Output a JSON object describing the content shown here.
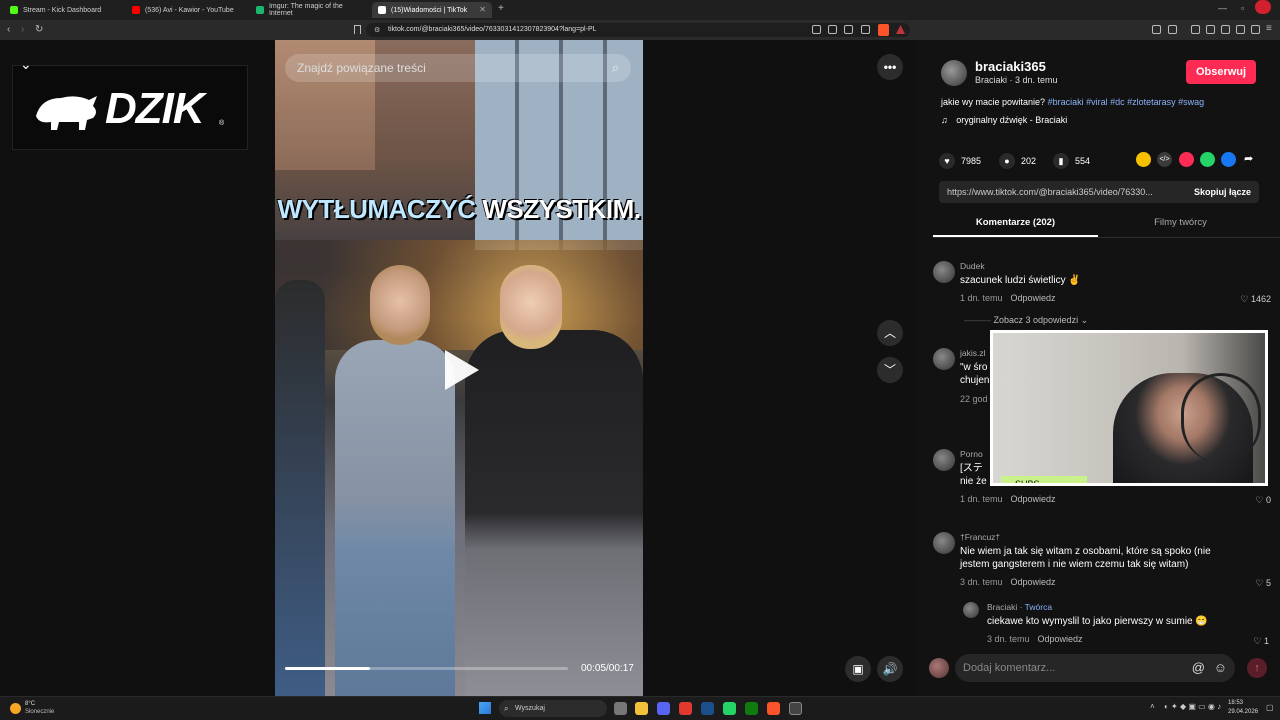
{
  "browser": {
    "tabs": [
      {
        "label": "Stream - Kick Dashboard",
        "color": "#53fc18"
      },
      {
        "label": "(536) Avi - Kawior - YouTube",
        "color": "#ff0000"
      },
      {
        "label": "Imgur: The magic of the Internet",
        "color": "#1bb76e"
      },
      {
        "label": "(15)Wiadomości | TikTok",
        "color": "#ffffff"
      }
    ],
    "new_tab": "+",
    "url": "tiktok.com/@braciaki365/video/7633031412307823904?lang=pl-PL"
  },
  "overlay": {
    "logo_text": "DZIK",
    "logo_mark": "®"
  },
  "video": {
    "search_placeholder": "Znajdź powiązane treści",
    "caption_highlight": "WYTŁUMACZYĆ",
    "caption_rest": "WSZYSTKIM.",
    "progress_fraction": 0.3,
    "time": "00:05/00:17"
  },
  "author": {
    "username": "braciaki365",
    "subline": "Braciaki · 3 dn. temu",
    "follow_label": "Obserwuj",
    "description_text": "jakie wy macie powitanie?",
    "description_tags": "#braciaki #viral #dc #zlotetarasy #swag",
    "music": "oryginalny dźwięk - Braciaki"
  },
  "stats": {
    "likes": "7985",
    "comments": "202",
    "saves": "554"
  },
  "share_colors": [
    "#f7c100",
    "#3a3a3a",
    "#fe2c55",
    "#25d366",
    "#1877f2"
  ],
  "link": {
    "url": "https://www.tiktok.com/@braciaki365/video/76330...",
    "copy_label": "Skopiuj łącze"
  },
  "tabs": {
    "comments": "Komentarze (202)",
    "creator_videos": "Filmy twórcy"
  },
  "comments": [
    {
      "name": "Dudek",
      "text": "szacunek ludzi świetlicy ✌",
      "time": "1 dn. temu",
      "reply": "Odpowiedz",
      "likes": "1462"
    },
    {
      "name": "jakis.zl",
      "text": "\"w śro",
      "text2": "chujen",
      "time": "22 god",
      "reply": "",
      "likes": ""
    },
    {
      "name": "Porno",
      "text": "[ステ",
      "text2": "nie że",
      "time": "1 dn. temu",
      "reply": "Odpowiedz",
      "likes": "0"
    },
    {
      "name": "†Francuz†",
      "text": "Nie wiem ja tak się witam z osobami, które są spoko (nie jestem gangsterem i nie wiem czemu tak się witam)",
      "time": "3 dn. temu",
      "reply": "Odpowiedz",
      "likes": "5"
    },
    {
      "name": "Braciaki",
      "badge": "Twórca",
      "text": "ciekawe kto wymyslil to jako pierwszy w sumie 😁",
      "time": "3 dn. temu",
      "reply": "Odpowiedz",
      "likes": "1"
    }
  ],
  "more_replies": "Zobacz 3 odpowiedzi",
  "webcam": {
    "subs_label": "SUBS"
  },
  "comment_input": {
    "placeholder": "Dodaj komentarz..."
  },
  "taskbar": {
    "weather_temp": "8°C",
    "weather_desc": "Słonecznie",
    "search": "Wyszukaj",
    "time": "18:53",
    "date": "29.04.2026"
  }
}
